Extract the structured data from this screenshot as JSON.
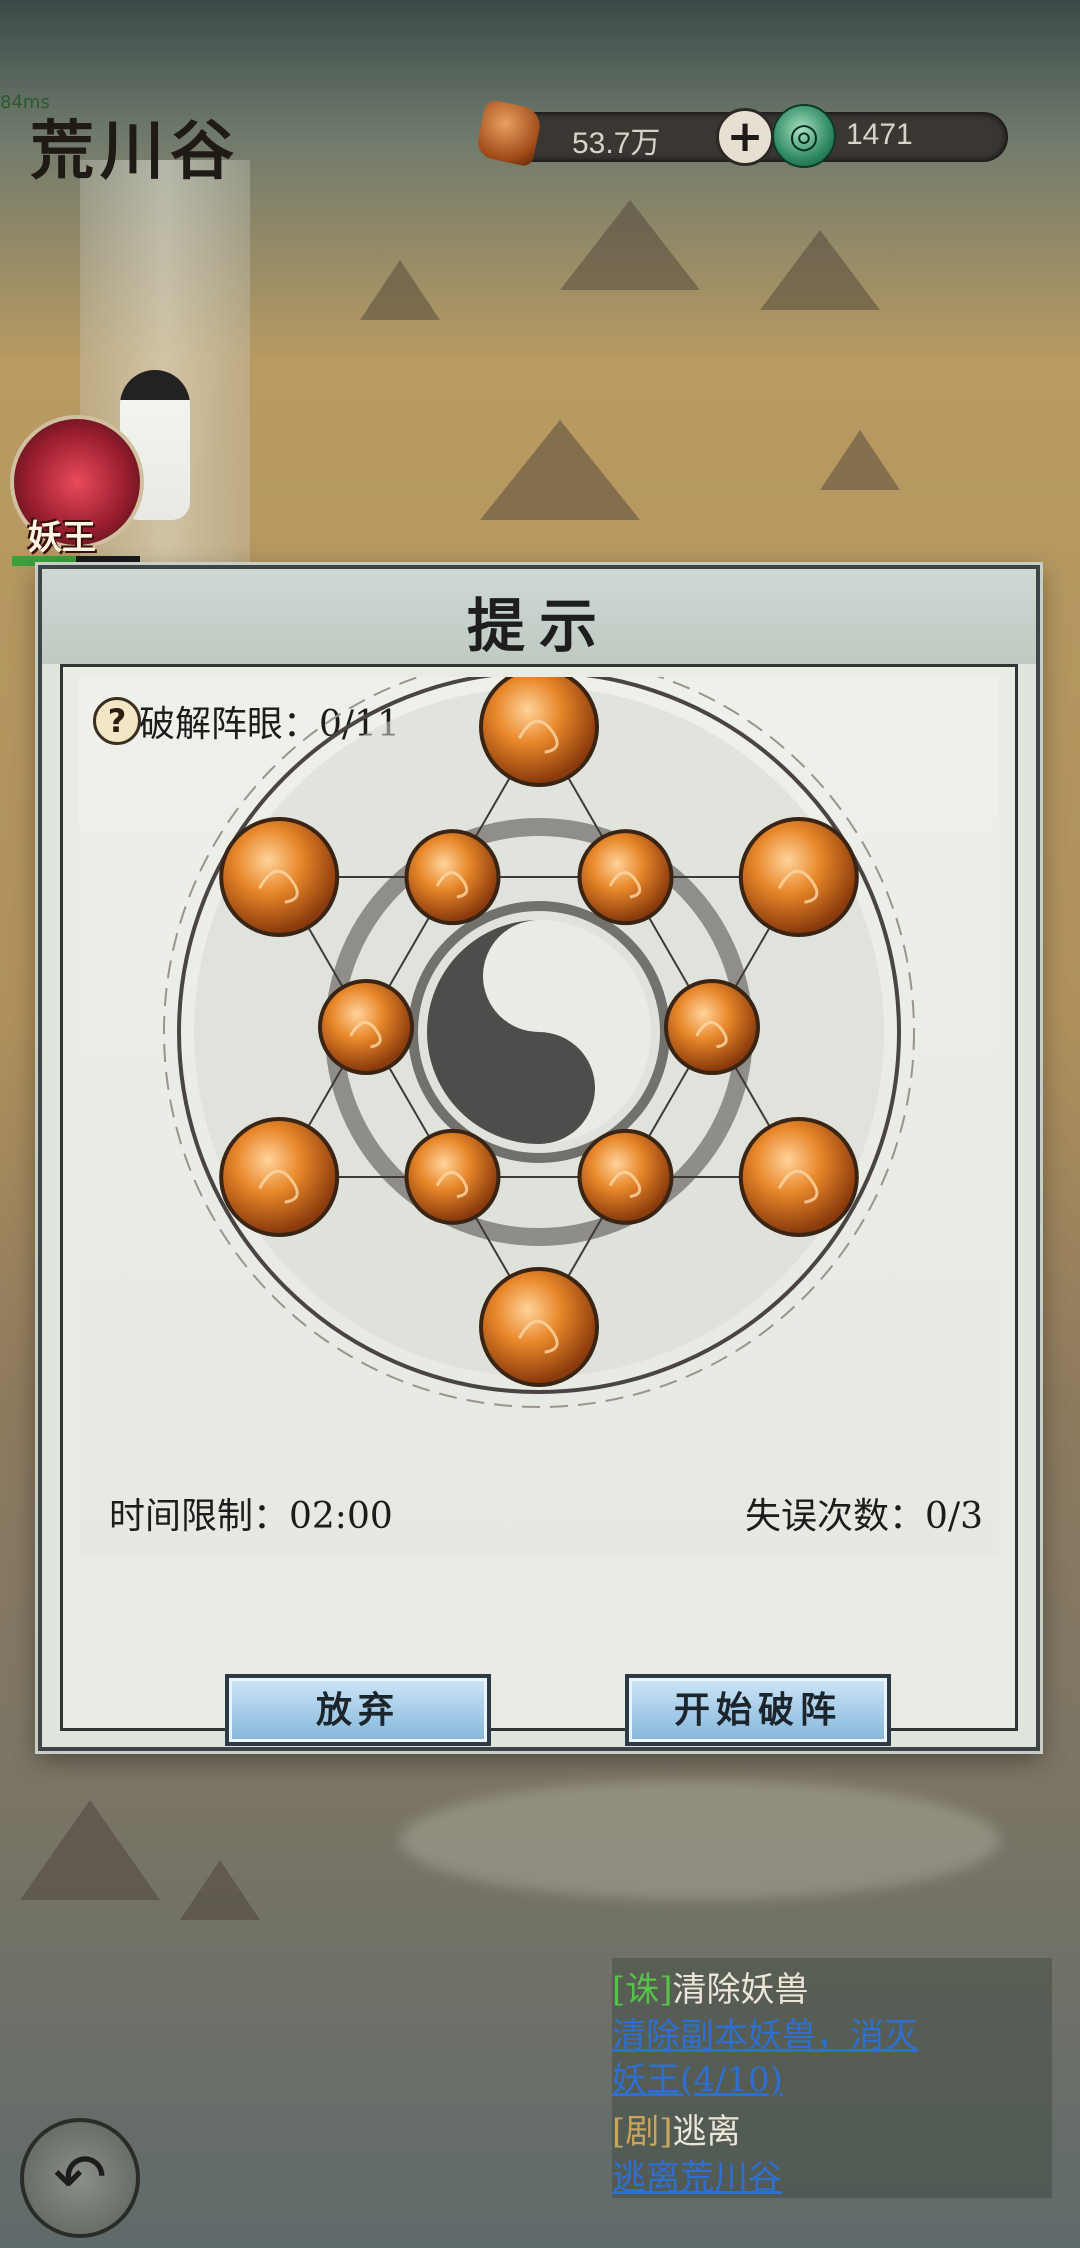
{
  "fps_text": "84ms",
  "area_title": "荒川谷",
  "resources": {
    "ore_value": "53.7万",
    "add_symbol": "+",
    "jade_value": "1471"
  },
  "boss": {
    "label": "妖王",
    "hp_fraction": 0.5
  },
  "dialog": {
    "title": "提示",
    "help_symbol": "?",
    "progress": "破解阵眼：0/11",
    "time_limit": "时间限制：02:00",
    "mistakes": "失误次数：0/3",
    "abandon_label": "放弃",
    "start_label": "开始破阵"
  },
  "puzzle": {
    "total_eyes": 11,
    "cracked": 0,
    "nodes": [
      {
        "id": "top",
        "ring": "outer",
        "size": "large"
      },
      {
        "id": "upper-left",
        "ring": "outer",
        "size": "large"
      },
      {
        "id": "upper-right",
        "ring": "outer",
        "size": "large"
      },
      {
        "id": "lower-left",
        "ring": "outer",
        "size": "large"
      },
      {
        "id": "lower-right",
        "ring": "outer",
        "size": "large"
      },
      {
        "id": "bottom",
        "ring": "outer",
        "size": "large"
      },
      {
        "id": "inner-top-left",
        "ring": "inner",
        "size": "small"
      },
      {
        "id": "inner-top-right",
        "ring": "inner",
        "size": "small"
      },
      {
        "id": "inner-left",
        "ring": "inner",
        "size": "small"
      },
      {
        "id": "inner-right",
        "ring": "inner",
        "size": "small"
      },
      {
        "id": "inner-bottom-left",
        "ring": "inner",
        "size": "small"
      },
      {
        "id": "inner-bottom-right",
        "ring": "inner",
        "size": "small"
      }
    ]
  },
  "quests": [
    {
      "tag": "[诛]",
      "name": "清除妖兽",
      "link_line1": "清除副本妖兽，消灭",
      "link_line2": "妖王(4/10)"
    },
    {
      "tag": "[剧]",
      "name": "逃离",
      "link_line1": "逃离荒川谷"
    }
  ],
  "back_symbol": "↶",
  "colors": {
    "orb": "#d8761f",
    "button_blue": "#9fc9e6",
    "quest_green": "#57c24a",
    "link_blue": "#2f6fd0"
  }
}
